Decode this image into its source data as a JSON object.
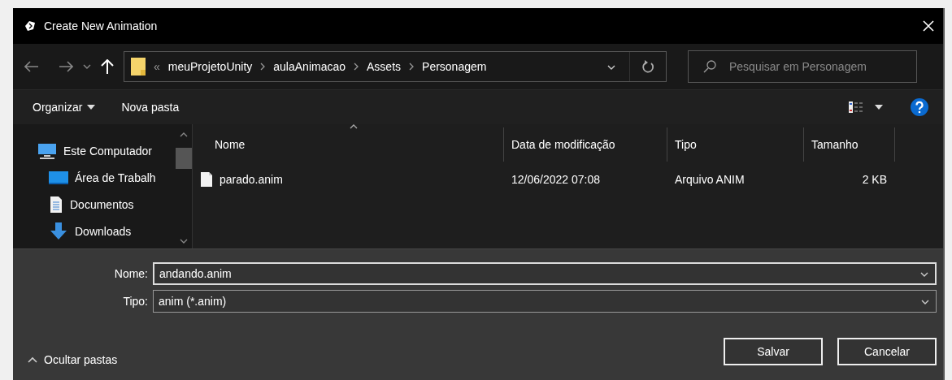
{
  "window": {
    "title": "Create New Animation"
  },
  "address_bar": {
    "overflow": "«",
    "path": [
      "meuProjetoUnity",
      "aulaAnimacao",
      "Assets",
      "Personagem"
    ]
  },
  "search": {
    "placeholder": "Pesquisar em Personagem"
  },
  "toolbar": {
    "organize": "Organizar",
    "new_folder": "Nova pasta"
  },
  "sidebar": {
    "items": [
      {
        "label": "Este Computador",
        "kind": "computer",
        "children": [
          {
            "label": "Área de Trabalh",
            "kind": "desktop"
          },
          {
            "label": "Documentos",
            "kind": "documents"
          },
          {
            "label": "Downloads",
            "kind": "downloads"
          }
        ]
      }
    ]
  },
  "table": {
    "columns": [
      {
        "label": "Nome",
        "sorted": true
      },
      {
        "label": "Data de modificação",
        "sorted": false
      },
      {
        "label": "Tipo",
        "sorted": false
      },
      {
        "label": "Tamanho",
        "sorted": false
      }
    ],
    "rows": [
      {
        "name": "parado.anim",
        "modified": "12/06/2022 07:08",
        "type": "Arquivo ANIM",
        "size": "2 KB"
      }
    ]
  },
  "form": {
    "name_label": "Nome:",
    "name_value": "andando.anim",
    "type_label": "Tipo:",
    "type_value": "anim (*.anim)"
  },
  "hide_folders": "Ocultar pastas",
  "buttons": [
    "Salvar",
    "Cancelar"
  ]
}
